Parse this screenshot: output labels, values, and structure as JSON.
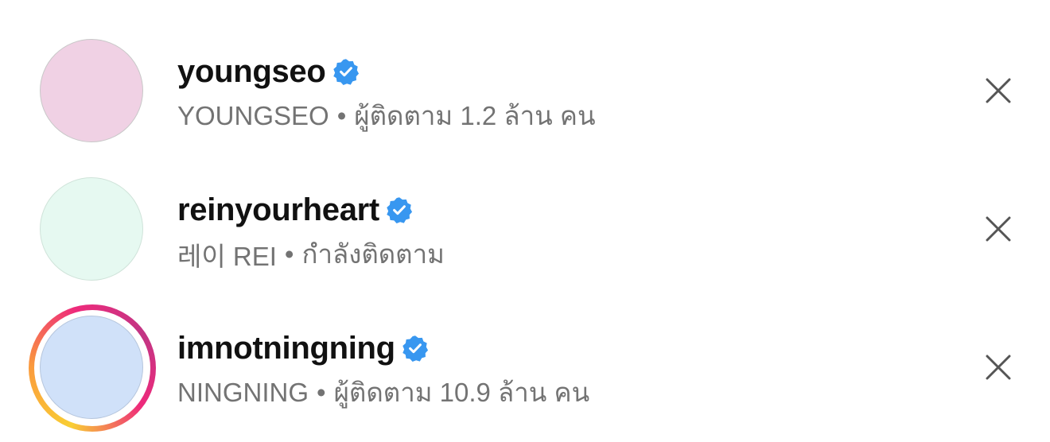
{
  "suggestions": [
    {
      "username": "youngseo",
      "display_name": "YOUNGSEO",
      "separator": "•",
      "detail": "ผู้ติดตาม 1.2 ล้าน คน",
      "verified": true,
      "avatar_color": "#f0d1e4",
      "has_story_ring": false,
      "dismiss_icon": "close-icon"
    },
    {
      "username": "reinyourheart",
      "display_name": "레이 REI",
      "separator": "•",
      "detail": "กำลังติดตาม",
      "verified": true,
      "avatar_color": "#e6f9f1",
      "has_story_ring": false,
      "dismiss_icon": "close-icon"
    },
    {
      "username": "imnotningning",
      "display_name": "NINGNING",
      "separator": "•",
      "detail": "ผู้ติดตาม 10.9 ล้าน คน",
      "verified": true,
      "avatar_color": "#d0e1f9",
      "has_story_ring": true,
      "dismiss_icon": "close-icon"
    }
  ],
  "colors": {
    "verified_badge": "#3897f0",
    "username_text": "#111111",
    "secondary_text": "#737373",
    "story_ring_gradient": [
      "#f9ce34",
      "#ee2a7b",
      "#c13584"
    ]
  }
}
